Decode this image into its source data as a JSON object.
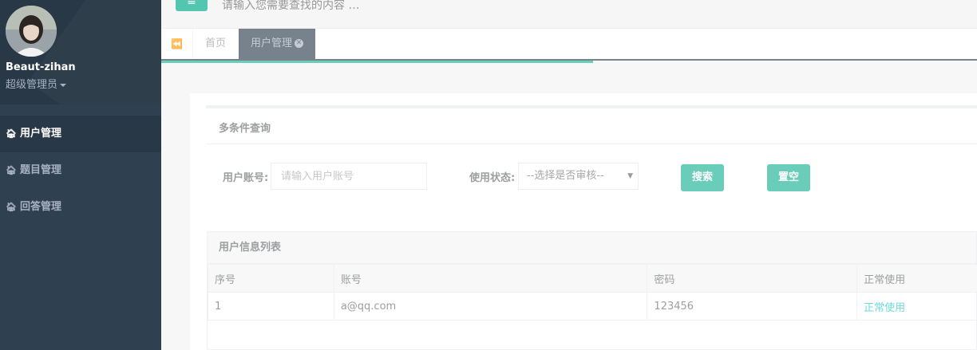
{
  "profile": {
    "name": "Beaut-zihan",
    "role": "超级管理员"
  },
  "sidebar": {
    "items": [
      {
        "label": "用户管理",
        "icon": "home-icon",
        "active": true
      },
      {
        "label": "题目管理",
        "icon": "home-icon",
        "active": false
      },
      {
        "label": "回答管理",
        "icon": "home-icon",
        "active": false
      }
    ]
  },
  "topbar": {
    "menu_icon": "≡",
    "search_placeholder": "请输入您需要查找的内容 …"
  },
  "tabs": {
    "back_icon": "⏪",
    "items": [
      {
        "label": "首页",
        "active": false
      },
      {
        "label": "用户管理",
        "active": true
      }
    ]
  },
  "query": {
    "title": "多条件查询",
    "account_label": "用户账号:",
    "account_placeholder": "请输入用户账号",
    "status_label": "使用状态:",
    "status_selected": "--选择是否审核--",
    "search_button": "搜索",
    "reset_button": "置空"
  },
  "user_list": {
    "title": "用户信息列表",
    "columns": [
      "序号",
      "账号",
      "密码",
      "正常使用"
    ],
    "rows": [
      {
        "index": "1",
        "account": "a@qq.com",
        "password": "123456",
        "status": "正常使用"
      }
    ]
  },
  "colors": {
    "sidebar_bg": "#2f4050",
    "accent": "#1ab394",
    "status_link": "#23c6c8"
  }
}
